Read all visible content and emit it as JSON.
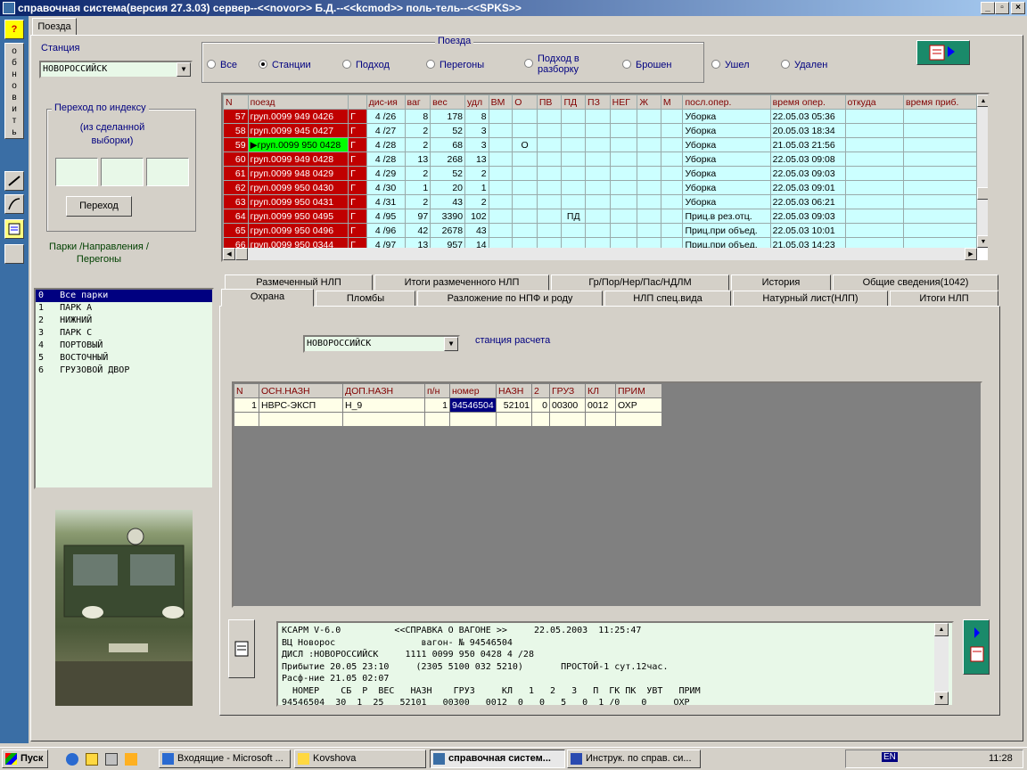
{
  "window": {
    "title": "справочная система(версия 27.3.03) сервер--<<novor>> Б.Д.--<<kcmod>> поль-тель--<<SPKS>>",
    "min": "_",
    "max": "▫",
    "close": "×"
  },
  "sidebar": {
    "help": "?",
    "refresh_letters": [
      "о",
      "б",
      "н",
      "о",
      "в",
      "и",
      "т",
      "ь"
    ]
  },
  "main_tab": "Поезда",
  "station": {
    "label": "Станция",
    "value": "НОВОРОССИЙСК"
  },
  "trains_group": {
    "title": "Поезда",
    "options": [
      "Все",
      "Станции",
      "Подход",
      "Перегоны",
      "Подход в разборку",
      "Брошен",
      "Ушел",
      "Удален"
    ],
    "selected": 1
  },
  "index_group": {
    "title": "Переход  по индексу",
    "subtitle": "(из сделанной выборки)",
    "button": "Переход"
  },
  "parks_label": "Парки /Направления / Перегоны",
  "parks": [
    "0   Все парки",
    "1   ПАРК А",
    "2   НИЖНИЙ",
    "3   ПАРК С",
    "4   ПОРТОВЫЙ",
    "5   ВОСТОЧНЫЙ",
    "6   ГРУЗОВОЙ ДВОР"
  ],
  "trains_table": {
    "headers": [
      "N",
      "поезд",
      "",
      "дис-ия",
      "ваг",
      "вес",
      "удл",
      "ВМ",
      "О",
      "ПВ",
      "ПД",
      "ПЗ",
      "НЕГ",
      "Ж",
      "М",
      "посл.опер.",
      "время опер.",
      "откуда",
      "время приб."
    ],
    "rows": [
      [
        "57",
        "груп.0099 949 0426",
        "Г",
        "4 /26",
        "8",
        "178",
        "8",
        "",
        "",
        "",
        "",
        "",
        "",
        "",
        "",
        "Уборка",
        "22.05.03 05:36",
        "",
        ""
      ],
      [
        "58",
        "груп.0099 945 0427",
        "Г",
        "4 /27",
        "2",
        "52",
        "3",
        "",
        "",
        "",
        "",
        "",
        "",
        "",
        "",
        "Уборка",
        "20.05.03 18:34",
        "",
        ""
      ],
      [
        "59",
        "груп.0099 950 0428",
        "Г",
        "4 /28",
        "2",
        "68",
        "3",
        "",
        "О",
        "",
        "",
        "",
        "",
        "",
        "",
        "Уборка",
        "21.05.03 21:56",
        "",
        ""
      ],
      [
        "60",
        "груп.0099 949 0428",
        "Г",
        "4 /28",
        "13",
        "268",
        "13",
        "",
        "",
        "",
        "",
        "",
        "",
        "",
        "",
        "Уборка",
        "22.05.03 09:08",
        "",
        ""
      ],
      [
        "61",
        "груп.0099 948 0429",
        "Г",
        "4 /29",
        "2",
        "52",
        "2",
        "",
        "",
        "",
        "",
        "",
        "",
        "",
        "",
        "Уборка",
        "22.05.03 09:03",
        "",
        ""
      ],
      [
        "62",
        "груп.0099 950 0430",
        "Г",
        "4 /30",
        "1",
        "20",
        "1",
        "",
        "",
        "",
        "",
        "",
        "",
        "",
        "",
        "Уборка",
        "22.05.03 09:01",
        "",
        ""
      ],
      [
        "63",
        "груп.0099 950 0431",
        "Г",
        "4 /31",
        "2",
        "43",
        "2",
        "",
        "",
        "",
        "",
        "",
        "",
        "",
        "",
        "Уборка",
        "22.05.03 06:21",
        "",
        ""
      ],
      [
        "64",
        "груп.0099 950 0495",
        "Г",
        "4 /95",
        "97",
        "3390",
        "102",
        "",
        "",
        "",
        "ПД",
        "",
        "",
        "",
        "",
        "Приц.в рез.отц.",
        "22.05.03 09:03",
        "",
        ""
      ],
      [
        "65",
        "груп.0099 950 0496",
        "Г",
        "4 /96",
        "42",
        "2678",
        "43",
        "",
        "",
        "",
        "",
        "",
        "",
        "",
        "",
        "Приц.при объед.",
        "22.05.03 10:01",
        "",
        ""
      ],
      [
        "66",
        "груп.0099 950 0344",
        "Г",
        "4 /97",
        "13",
        "957",
        "14",
        "",
        "",
        "",
        "",
        "",
        "",
        "",
        "",
        "Приц.при объед.",
        "21.05.03 14:23",
        "",
        ""
      ]
    ],
    "selected_row": 2
  },
  "tabs_row1": [
    "Размеченный НЛП",
    "Итоги размеченного НЛП",
    "Гр/Пор/Нер/Пас/НДЛМ",
    "История",
    "Общие сведения(1042)"
  ],
  "tabs_row2": [
    "Охрана",
    "Пломбы",
    "Разложение по НПФ и роду",
    "НЛП спец.вида",
    "Натурный лист(НЛП)",
    "Итоги НЛП"
  ],
  "calc_station": {
    "value": "НОВОРОССИЙСК",
    "label": "станция расчета"
  },
  "guard_table": {
    "headers": [
      "N",
      "ОСН.НАЗН",
      "ДОП.НАЗН",
      "п/н",
      "номер",
      "НАЗН",
      "2",
      "ГРУЗ",
      "КЛ",
      "ПРИМ"
    ],
    "rows": [
      [
        "1",
        "НВРС-ЭКСП",
        "Н_9",
        "1",
        "94546504",
        "52101",
        "0",
        "00300",
        "0012",
        "ОХР"
      ]
    ]
  },
  "memo": {
    "lines": [
      "КСАРМ V-6.0          <<СПРАВКА О ВАГОНЕ >>     22.05.2003  11:25:47",
      "ВЦ Новорос                вагон- № 94546504",
      "ДИСЛ :НОВОРОССИЙСК     1111 0099 950 0428 4 /28",
      "Прибытие 20.05 23:10     (2305 5100 032 5210)       ПРОСТОЙ-1 сут.12час.",
      "Расф-ние 21.05 02:07",
      "  НОМЕР    СБ  Р  ВЕС   НАЗН    ГРУЗ     КЛ   1   2   3   П  ГК ПК  УВТ   ПРИМ",
      "94546504  30  1  25   52101   00300   0012  0   0   5   0  1 /0    0     ОХР"
    ]
  },
  "taskbar": {
    "start": "Пуск",
    "tasks": [
      "Входящие - Microsoft ...",
      "Kovshova",
      "справочная систем...",
      "Инструк. по справ. си..."
    ],
    "lang": "EN",
    "time": "11:28"
  }
}
